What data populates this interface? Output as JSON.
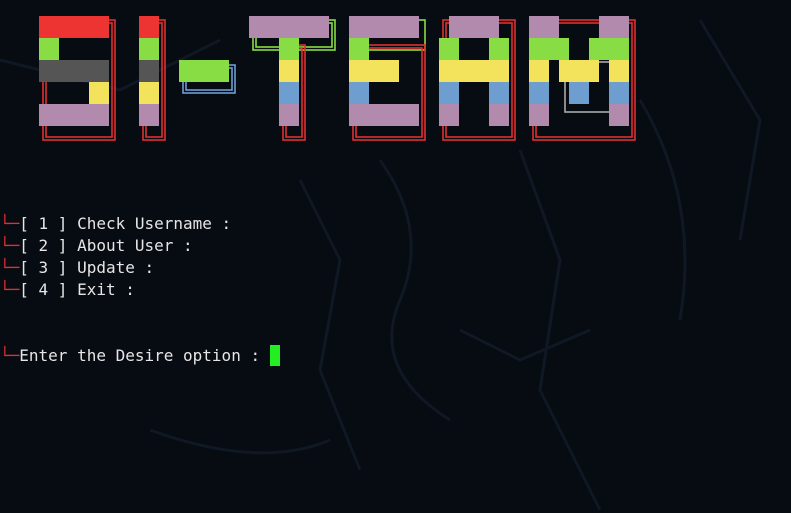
{
  "banner": {
    "text": "SI-TEAM",
    "colors": {
      "red": "#ee3333",
      "green": "#88dd44",
      "gray": "#555555",
      "yellow": "#f2e25c",
      "blue": "#6e9ed0",
      "purple": "#b28aae",
      "outline_red": "#e03030",
      "outline_green": "#88dd44",
      "outline_blue": "#6e9ed0",
      "outline_gray": "#aaaaaa"
    }
  },
  "menu": {
    "corner_glyph": "└─",
    "items": [
      {
        "label": "[ 1 ] Check Username :"
      },
      {
        "label": "[ 2 ] About User :"
      },
      {
        "label": "[ 3 ] Update :"
      },
      {
        "label": "[ 4 ] Exit :"
      }
    ]
  },
  "prompt": {
    "corner_glyph": "└─",
    "label": "Enter the Desire option : "
  },
  "theme": {
    "background": "#070b12",
    "text": "#e6e6e6",
    "corner": "#e03030",
    "cursor": "#22ee22"
  }
}
